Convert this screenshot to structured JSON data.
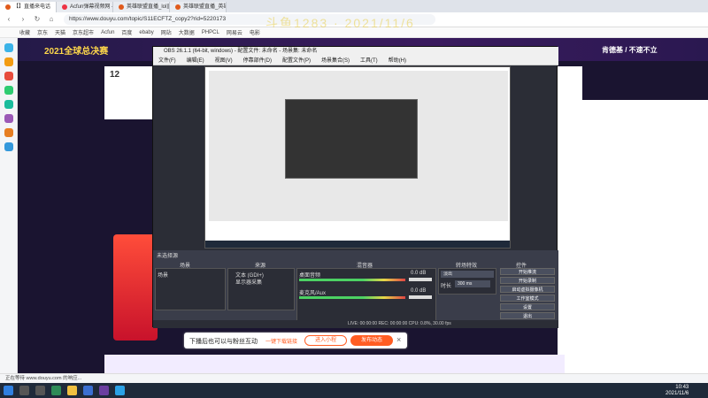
{
  "browser": {
    "tabs": [
      {
        "label": "【】直播来电话"
      },
      {
        "label": "Acfun弹幕视频网 - 认真你就输了"
      },
      {
        "label": "英雄联盟直播_lol直播_英雄联盟"
      },
      {
        "label": "英雄联盟直播_英雄联盟比赛直播"
      }
    ],
    "url": "https://www.douyu.com/topic/S11ECFTZ_copy2?rid=5220173",
    "watermark": "斗鱼1283 · 2021/11/6",
    "bookmarks": [
      "收藏",
      "京东",
      "天猫",
      "京东超市",
      "Acfun",
      "百度",
      "ebaby",
      "网站",
      "大数据",
      "PHPCL",
      "网易云",
      "电影"
    ],
    "status_text": "正在等待 www.douyu.com 的响应..."
  },
  "douyu": {
    "logo": "2021全球总决赛",
    "streamer_name": "肯德基 / 不速不立",
    "fans_count": "12"
  },
  "obs": {
    "title": "OBS 26.1.1 (64-bit, windows) - 配置文件: 未命名 - 场景集: 未命名",
    "menu": [
      "文件(F)",
      "编辑(E)",
      "视图(V)",
      "停靠部件(D)",
      "配置文件(P)",
      "场景集合(S)",
      "工具(T)",
      "帮助(H)"
    ],
    "scene_label": "未选择源",
    "panels": {
      "scenes_header": "场景",
      "sources_header": "来源",
      "mixer_header": "混音器",
      "transitions_header": "转场特效",
      "controls_header": "控件",
      "scene_item": "场景",
      "sources": [
        "文本 (GDI+)",
        "显示器采集"
      ],
      "mixer_tracks": [
        "桌面音频",
        "麦克风/Aux"
      ],
      "mixer_db": [
        "0.0 dB",
        "0.0 dB"
      ],
      "transition": "淡出",
      "duration_label": "时长",
      "duration_value": "300 ms",
      "controls": [
        "开始推流",
        "开始录制",
        "启动虚拟摄像机",
        "工作室模式",
        "设置",
        "退出"
      ]
    },
    "status": "LIVE: 00:00:00    REC: 00:00:00    CPU: 0.8%, 30.00 fps"
  },
  "notice": {
    "text": "下播后也可以与粉丝互动",
    "link": "一键下载链接",
    "btn_primary": "进入小程",
    "btn_secondary": "发布动态",
    "close": "×"
  },
  "taskbar": {
    "time": "10:43",
    "date": "2021/11/6"
  }
}
